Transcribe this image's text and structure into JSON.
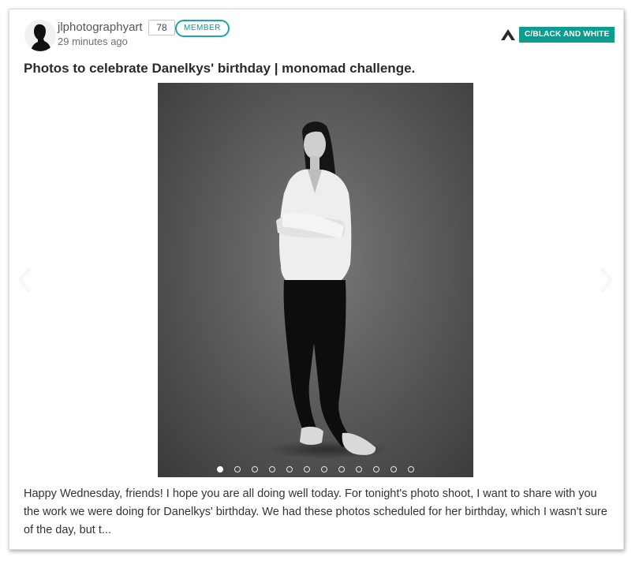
{
  "post": {
    "author": "jlphotographyart",
    "reputation": "78",
    "badge": "MEMBER",
    "time": "29 minutes ago",
    "community_tag": "C/BLACK AND WHITE",
    "title": "Photos to celebrate Danelkys' birthday | monomad challenge.",
    "excerpt": "Happy Wednesday, friends! I hope you are all doing well today. For tonight's photo shoot, I want to share with you the work we were doing for Danelkys' birthday. We had these photos scheduled for her birthday, which I wasn't sure of the day, but t..."
  },
  "carousel": {
    "slide_count": 12,
    "active_index": 0
  },
  "icons": {
    "avatar": "user-silhouette-avatar",
    "community": "community-logo-icon",
    "prev": "chevron-left-icon",
    "next": "chevron-right-icon"
  },
  "colors": {
    "tag_bg": "#0f9b8e",
    "badge_border": "#1aa5b0",
    "text": "#2b2b2b"
  }
}
